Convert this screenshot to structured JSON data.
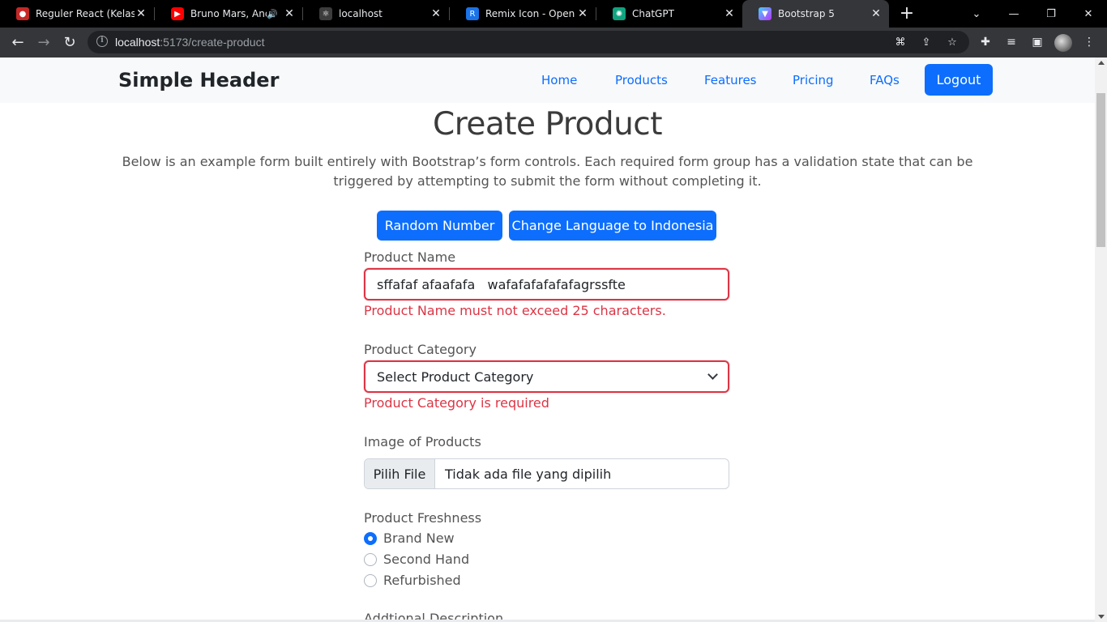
{
  "browser": {
    "tabs": [
      {
        "title": "Reguler React (Kelas A",
        "icon": "drop-icon",
        "color": "#e53935"
      },
      {
        "title": "Bruno Mars, Ande",
        "icon": "youtube-icon",
        "color": "#ff0000",
        "audio": "🔊"
      },
      {
        "title": "localhost",
        "icon": "react-icon",
        "color": "#61dafb"
      },
      {
        "title": "Remix Icon - Open so",
        "icon": "remix-icon",
        "color": "#1a73e8"
      },
      {
        "title": "ChatGPT",
        "icon": "chatgpt-icon",
        "color": "#10a37f"
      },
      {
        "title": "Bootstrap 5",
        "icon": "vite-icon",
        "color": "#a855f7",
        "active": true
      }
    ],
    "new_tab": "+",
    "url_host": "localhost",
    "url_path": ":5173/create-product"
  },
  "header": {
    "brand": "Simple Header",
    "nav": [
      "Home",
      "Products",
      "Features",
      "Pricing",
      "FAQs"
    ],
    "logout": "Logout"
  },
  "page": {
    "title": "Create Product",
    "lead": "Below is an example form built entirely with Bootstrap’s form controls. Each required form group has a validation state that can be triggered by attempting to submit the form without completing it.",
    "random_button": "Random Number",
    "language_button": "Change Language to Indonesia"
  },
  "form": {
    "product_name": {
      "label": "Product Name",
      "value": "sffafaf afaafafa   wafafafafafafagrssfte",
      "error": "Product Name must not exceed 25 characters."
    },
    "product_category": {
      "label": "Product Category",
      "selected": "Select Product Category",
      "error": "Product Category is required"
    },
    "image": {
      "label": "Image of Products",
      "button": "Pilih File",
      "status": "Tidak ada file yang dipilih"
    },
    "freshness": {
      "label": "Product Freshness",
      "options": [
        "Brand New",
        "Second Hand",
        "Refurbished"
      ],
      "selected_index": 0
    },
    "description": {
      "label": "Addtional Description"
    }
  },
  "colors": {
    "primary": "#0d6efd",
    "danger": "#dc3545"
  }
}
